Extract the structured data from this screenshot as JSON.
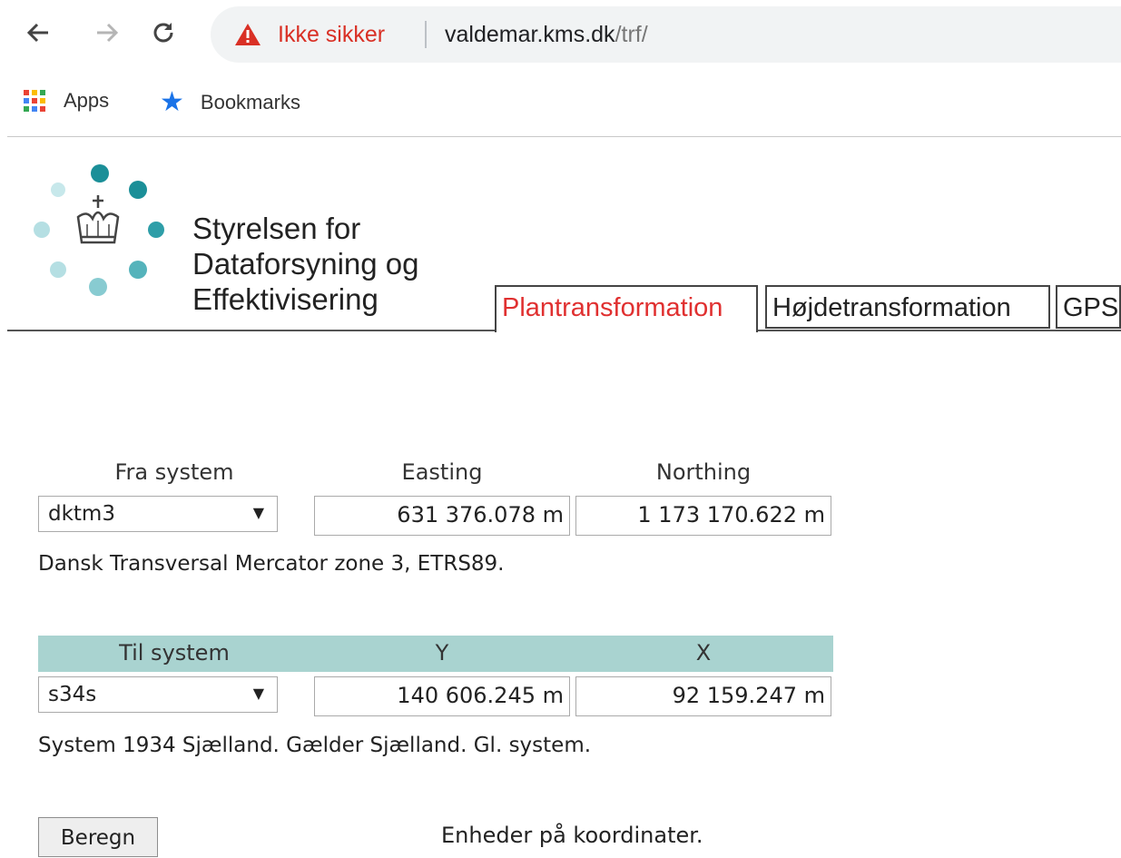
{
  "browser": {
    "security_warning": "Ikke sikker",
    "url_host": "valdemar.kms.dk",
    "url_path": "/trf/",
    "bookmarks": [
      {
        "label": "Apps",
        "icon": "apps-grid-icon"
      },
      {
        "label": "Bookmarks",
        "icon": "star-icon"
      }
    ],
    "colors": {
      "warning": "#d93025",
      "star": "#1a73e8"
    }
  },
  "header": {
    "agency_lines": [
      "Styrelsen for",
      "Dataforsyning og",
      "Effektivisering"
    ],
    "tabs": [
      {
        "label": "Plantransformation",
        "active": true
      },
      {
        "label": "Højdetransformation",
        "active": false
      },
      {
        "label": "GPS",
        "active": false
      }
    ],
    "colors": {
      "active_tab": "#e03030",
      "logo_dark": "#1b8f98",
      "logo_light": "#b5dfe3"
    }
  },
  "from": {
    "system_label": "Fra system",
    "col1_label": "Easting",
    "col2_label": "Northing",
    "system_value": "dktm3",
    "easting": "631 376.078 m",
    "northing": "1 173 170.622 m",
    "description": "Dansk Transversal Mercator zone 3, ETRS89."
  },
  "to": {
    "system_label": "Til system",
    "col1_label": "Y",
    "col2_label": "X",
    "system_value": "s34s",
    "y": "140 606.245 m",
    "x": "92 159.247 m",
    "description": "System 1934 Sjælland. Gælder Sjælland. Gl. system.",
    "band_color": "#a9d3d0"
  },
  "actions": {
    "calculate_label": "Beregn",
    "units_link": "Enheder på koordinater."
  }
}
